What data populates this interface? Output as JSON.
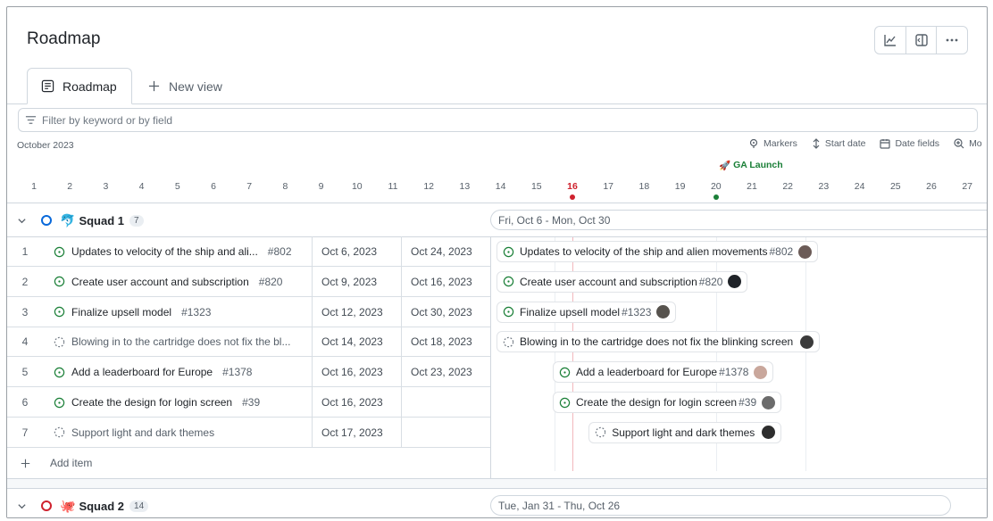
{
  "app": {
    "title": "Roadmap"
  },
  "top_actions": {
    "icons": [
      "chart-icon",
      "panel-icon",
      "more-icon"
    ]
  },
  "tabs": [
    {
      "label": "Roadmap",
      "active": true,
      "icon": "table-icon"
    },
    {
      "label": "New view",
      "active": false,
      "icon": "plus-icon"
    }
  ],
  "filter": {
    "placeholder": "Filter by keyword or by field"
  },
  "timeline": {
    "month_label": "October 2023",
    "toolbar": {
      "markers": "Markers",
      "start_date": "Start date",
      "date_fields": "Date fields",
      "more": "Mo"
    },
    "marker_label": "GA Launch",
    "days": [
      "1",
      "2",
      "3",
      "4",
      "5",
      "6",
      "7",
      "8",
      "9",
      "10",
      "11",
      "12",
      "13",
      "14",
      "15",
      "16",
      "17",
      "18",
      "19",
      "20",
      "21",
      "22",
      "23",
      "24",
      "25",
      "26",
      "27"
    ],
    "today": "16",
    "marker_day": "20"
  },
  "groups": [
    {
      "name": "Squad 1",
      "count": "7",
      "emoji": "🐬",
      "status_color": "#0969da",
      "range": "Fri, Oct 6 - Mon, Oct 30",
      "items": [
        {
          "num": "1",
          "title": "Updates to velocity of the ship and ali...",
          "bar_title": "Updates to velocity of the ship and alien movements",
          "issue": "#802",
          "start": "Oct 6, 2023",
          "end": "Oct 24, 2023",
          "draft": false
        },
        {
          "num": "2",
          "title": "Create user account and subscription",
          "bar_title": "Create user account and subscription",
          "issue": "#820",
          "start": "Oct 9, 2023",
          "end": "Oct 16, 2023",
          "draft": false
        },
        {
          "num": "3",
          "title": "Finalize upsell model",
          "bar_title": "Finalize upsell model",
          "issue": "#1323",
          "start": "Oct 12, 2023",
          "end": "Oct 30, 2023",
          "draft": false
        },
        {
          "num": "4",
          "title": "Blowing in to the cartridge does not fix the bl...",
          "bar_title": "Blowing in to the cartridge does not fix the blinking screen",
          "issue": "",
          "start": "Oct 14, 2023",
          "end": "Oct 18, 2023",
          "draft": true
        },
        {
          "num": "5",
          "title": "Add a leaderboard for Europe",
          "bar_title": "Add a leaderboard for Europe",
          "issue": "#1378",
          "start": "Oct 16, 2023",
          "end": "Oct 23, 2023",
          "draft": false
        },
        {
          "num": "6",
          "title": "Create the design for login screen",
          "bar_title": "Create the design for login screen",
          "issue": "#39",
          "start": "Oct 16, 2023",
          "end": "",
          "draft": false
        },
        {
          "num": "7",
          "title": "Support light and dark themes",
          "bar_title": "Support light and dark themes",
          "issue": "",
          "start": "Oct 17, 2023",
          "end": "",
          "draft": true
        }
      ],
      "add_item": "Add item"
    },
    {
      "name": "Squad 2",
      "count": "14",
      "emoji": "🐙",
      "status_color": "#cf222e",
      "range": "Tue, Jan 31 - Thu, Oct 26"
    }
  ]
}
